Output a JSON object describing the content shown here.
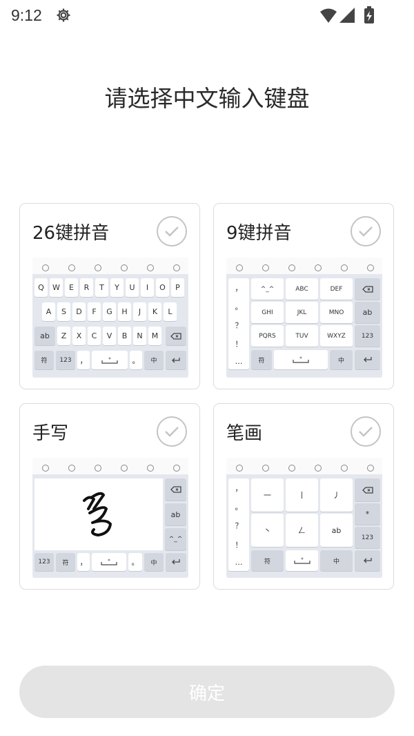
{
  "status_bar": {
    "time": "9:12"
  },
  "title": "请选择中文输入键盘",
  "cards": [
    {
      "label": "26键拼音",
      "keyboard": {
        "row1": [
          "Q",
          "W",
          "E",
          "R",
          "T",
          "Y",
          "U",
          "I",
          "O",
          "P"
        ],
        "row2": [
          "A",
          "S",
          "D",
          "F",
          "G",
          "H",
          "J",
          "K",
          "L"
        ],
        "row3": [
          "Z",
          "X",
          "C",
          "V",
          "B",
          "N",
          "M"
        ],
        "ab": "ab",
        "sym": "符",
        "num": "123",
        "comma": "，",
        "dot": "。",
        "zh": "中"
      }
    },
    {
      "label": "9键拼音",
      "keyboard": {
        "side": [
          "，",
          "。",
          "？",
          "！",
          "…"
        ],
        "grid": [
          "^_^",
          "ABC",
          "DEF",
          "GHI",
          "JKL",
          "MNO",
          "PQRS",
          "TUV",
          "WXYZ"
        ],
        "ab": "ab",
        "num": "123",
        "sym": "符",
        "zh": "中"
      }
    },
    {
      "label": "手写",
      "keyboard": {
        "ab": "ab",
        "emoji": "^_^",
        "num": "123",
        "sym": "符",
        "comma": "，",
        "dot": "。",
        "zh": "中"
      }
    },
    {
      "label": "笔画",
      "keyboard": {
        "side": [
          "，",
          "。",
          "？",
          "！",
          "…"
        ],
        "grid": [
          "一",
          "丨",
          "丿",
          "丶",
          "𠃋",
          "ab"
        ],
        "star": "*",
        "num": "123",
        "sym": "符",
        "zh": "中"
      }
    }
  ],
  "confirm_label": "确定"
}
